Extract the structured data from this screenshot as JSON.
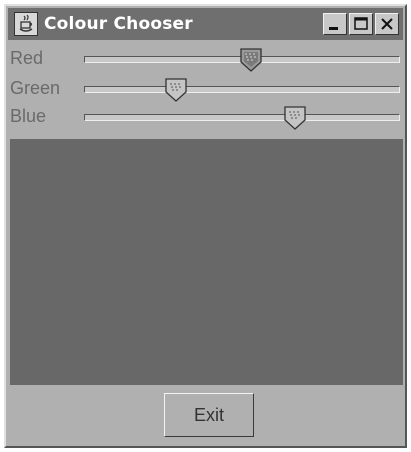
{
  "window": {
    "title": "Colour Chooser"
  },
  "sliders": [
    {
      "label": "Red",
      "value": 0.53
    },
    {
      "label": "Green",
      "value": 0.29
    },
    {
      "label": "Blue",
      "value": 0.67
    }
  ],
  "preview": {
    "color": "#686868"
  },
  "exit_label": "Exit",
  "colors": {
    "titlebar": "#6f6f6f",
    "window_bg": "#b0b0b0"
  }
}
